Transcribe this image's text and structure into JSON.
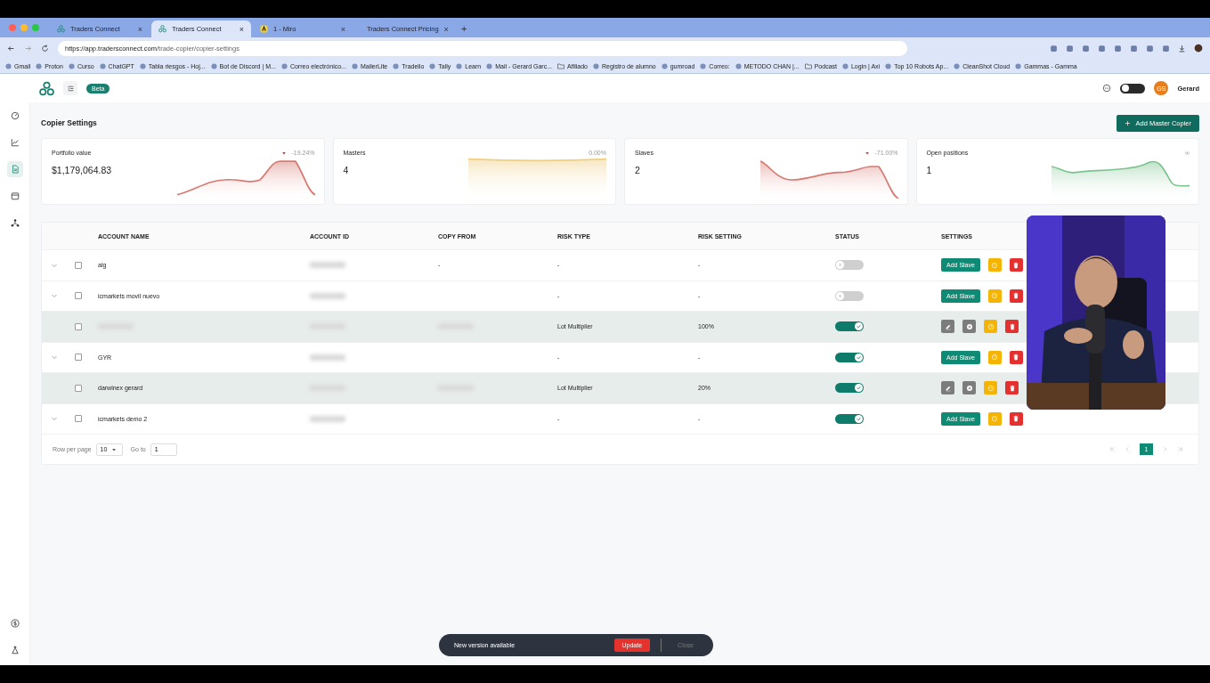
{
  "browser": {
    "tabs": [
      {
        "title": "Traders Connect",
        "selected": false,
        "kind": "app",
        "close": "×"
      },
      {
        "title": "Traders Connect",
        "selected": true,
        "kind": "app",
        "close": "×"
      },
      {
        "title": "1 - Miro",
        "selected": false,
        "kind": "miro",
        "close": "×"
      },
      {
        "title": "Traders Connect Pricing",
        "selected": false,
        "kind": "app",
        "close": "×"
      }
    ],
    "new_tab": "+",
    "url_host": "https://app.tradersconnect.com",
    "url_path": "/trade-copier/copier-settings",
    "bookmarks": [
      {
        "label": "Gmail",
        "kind": "site"
      },
      {
        "label": "Proton",
        "kind": "site"
      },
      {
        "label": "Curso",
        "kind": "site"
      },
      {
        "label": "ChatGPT",
        "kind": "site"
      },
      {
        "label": "Tabla riesgos - Hoj...",
        "kind": "site"
      },
      {
        "label": "Bot de Discord | M...",
        "kind": "site"
      },
      {
        "label": "Correo electrónico...",
        "kind": "site"
      },
      {
        "label": "MailerLite",
        "kind": "site"
      },
      {
        "label": "Tradelio",
        "kind": "site"
      },
      {
        "label": "Tally",
        "kind": "site"
      },
      {
        "label": "Learn",
        "kind": "site"
      },
      {
        "label": "Mail - Gerard Garc...",
        "kind": "site"
      },
      {
        "label": "Afiliado",
        "kind": "folder"
      },
      {
        "label": "Registro de alumno",
        "kind": "site"
      },
      {
        "label": "gumroad",
        "kind": "site"
      },
      {
        "label": "Correo:",
        "kind": "site"
      },
      {
        "label": "METODO CHAN |...",
        "kind": "site"
      },
      {
        "label": "Podcast",
        "kind": "folder"
      },
      {
        "label": "Login | Axi",
        "kind": "site"
      },
      {
        "label": "Top 10 Robots Ap...",
        "kind": "site"
      },
      {
        "label": "CleanShot Cloud",
        "kind": "site"
      },
      {
        "label": "Gammas - Gamma",
        "kind": "site"
      }
    ]
  },
  "header": {
    "badge": "Beta",
    "dark_mode": false,
    "avatar": "GS",
    "user": "Gerard"
  },
  "page": {
    "title": "Copier Settings",
    "action": "Add Master Copier"
  },
  "stats": [
    {
      "label": "Portfolio value",
      "value": "$1,179,064.83",
      "change": "-19.24%",
      "falling": true,
      "color": "#d77a72"
    },
    {
      "label": "Masters",
      "value": "4",
      "change": "0.00%",
      "falling": false,
      "color": "#f0cf82"
    },
    {
      "label": "Slaves",
      "value": "2",
      "change": "-71.00%",
      "falling": true,
      "color": "#d77a72"
    },
    {
      "label": "Open positions",
      "value": "1",
      "change": "∞",
      "falling": false,
      "color": "#7cc48f"
    }
  ],
  "table": {
    "columns": [
      "ACCOUNT NAME",
      "ACCOUNT ID",
      "COPY FROM",
      "RISK TYPE",
      "RISK SETTING",
      "STATUS",
      "SETTINGS"
    ],
    "rows": [
      {
        "kind": "master",
        "name": "alg",
        "copy_from": "-",
        "risk_type": "-",
        "risk_setting": "-",
        "on": false,
        "checked": false,
        "action": "Add Slave"
      },
      {
        "kind": "master",
        "name": "icmarkets movil nuevo",
        "risk_type": "-",
        "risk_setting": "-",
        "on": false,
        "checked": false,
        "action": "Add Slave"
      },
      {
        "kind": "slave",
        "risk_type": "Lot Multiplier",
        "risk_setting": "100%",
        "on": true,
        "checked": false
      },
      {
        "kind": "master",
        "name": "GYR",
        "risk_type": "-",
        "risk_setting": "-",
        "on": true,
        "checked": false,
        "action": "Add Slave"
      },
      {
        "kind": "slave",
        "name": "darwinex gerard",
        "risk_type": "Lot Multiplier",
        "risk_setting": "20%",
        "on": true,
        "checked": false
      },
      {
        "kind": "master",
        "name": "icmarkets demo 2",
        "risk_type": "-",
        "risk_setting": "-",
        "on": true,
        "checked": false,
        "action": "Add Slave"
      }
    ],
    "pagination": {
      "rows_label": "Row per page",
      "rows_value": "10",
      "goto_label": "Go to",
      "goto_value": "1",
      "pages": [
        {
          "label": "1",
          "selected": true
        }
      ]
    }
  },
  "toast": {
    "message": "New version available",
    "action": "Update",
    "dismiss": "Close"
  }
}
